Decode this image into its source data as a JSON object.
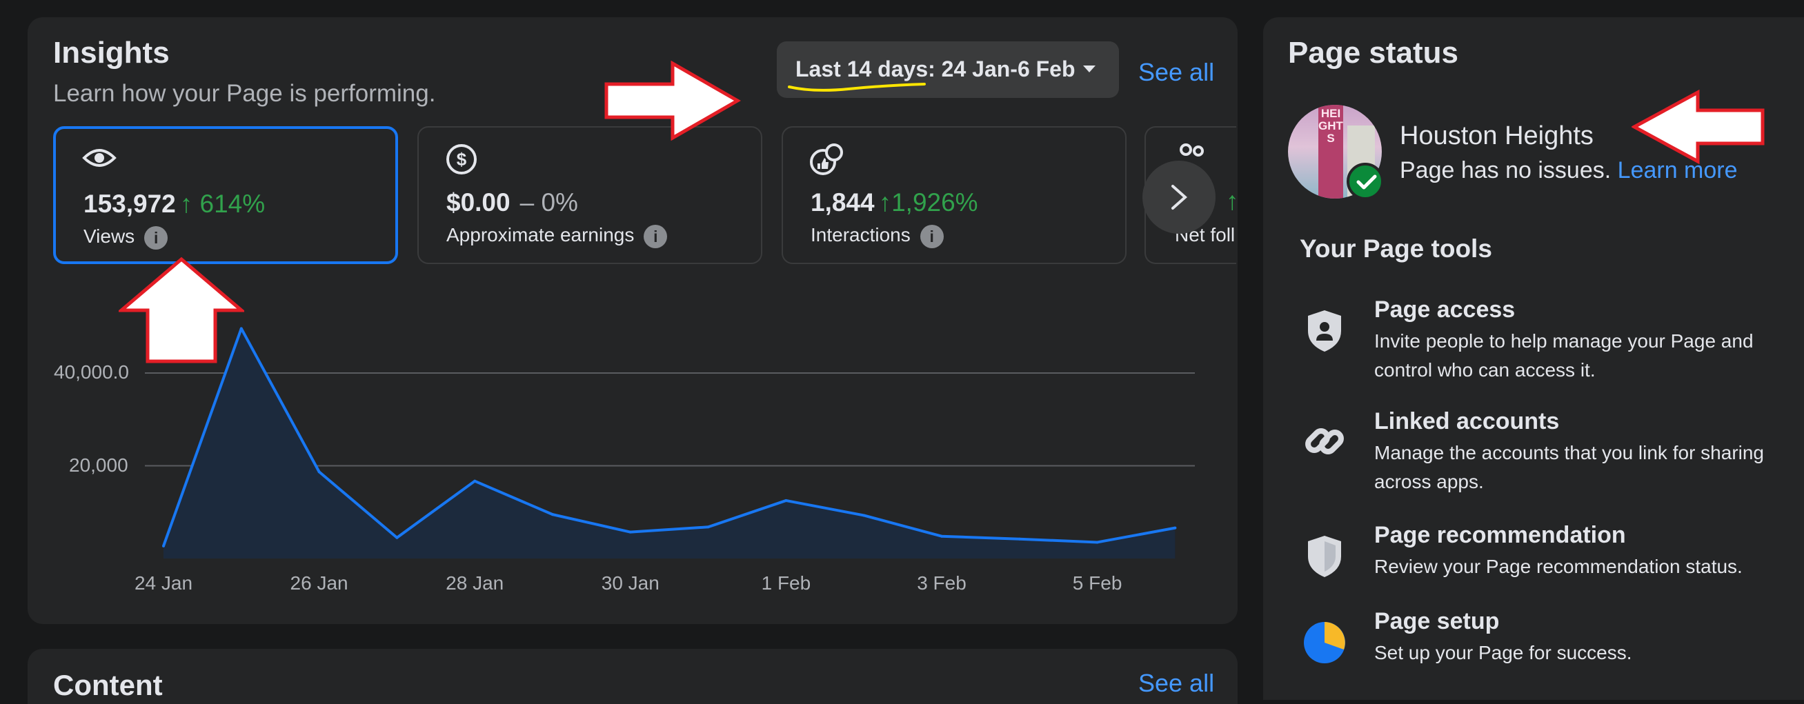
{
  "insights": {
    "title": "Insights",
    "subtitle": "Learn how your Page is performing.",
    "date_range_label": "Last 14 days: 24 Jan-6 Feb",
    "see_all": "See all",
    "metrics": [
      {
        "value": "153,972",
        "change": "614%",
        "change_prefix": "↑",
        "label": "Views",
        "selected": true
      },
      {
        "value": "$0.00",
        "change": "– 0%",
        "change_prefix": "",
        "label": "Approximate earnings",
        "selected": false
      },
      {
        "value": "1,844",
        "change": "1,926%",
        "change_prefix": "↑",
        "label": "Interactions",
        "selected": false
      },
      {
        "value": "",
        "change": "",
        "change_prefix": "↑",
        "label": "Net foll",
        "selected": false
      }
    ],
    "info_glyph": "i"
  },
  "chart_data": {
    "type": "area",
    "x": [
      "24 Jan",
      "25 Jan",
      "26 Jan",
      "27 Jan",
      "28 Jan",
      "29 Jan",
      "30 Jan",
      "31 Jan",
      "1 Feb",
      "2 Feb",
      "3 Feb",
      "4 Feb",
      "5 Feb",
      "6 Feb"
    ],
    "x_tick_labels": [
      "24 Jan",
      "26 Jan",
      "28 Jan",
      "30 Jan",
      "1 Feb",
      "3 Feb",
      "5 Feb"
    ],
    "series": [
      {
        "values": [
          2700,
          49600,
          18700,
          4500,
          16700,
          9500,
          5700,
          6800,
          12500,
          9300,
          4800,
          4200,
          3500,
          6600
        ]
      }
    ],
    "y_tick_labels": [
      "40,000.0",
      "20,000"
    ],
    "y_ticks": [
      40000,
      20000
    ],
    "ylim": [
      0,
      50000
    ],
    "grid": true,
    "line_color": "#1877f2"
  },
  "content_card": {
    "title": "Content",
    "see_all": "See all"
  },
  "page_status": {
    "title": "Page status",
    "page_name": "Houston Heights",
    "status_text": "Page has no issues.",
    "learn_more": "Learn more",
    "avatar_sign_text": "HEIGHTS"
  },
  "tools": {
    "title": "Your Page tools",
    "items": [
      {
        "title": "Page access",
        "desc": "Invite people to help manage your Page and control who can access it.",
        "icon": "shield-person-icon"
      },
      {
        "title": "Linked accounts",
        "desc": "Manage the accounts that you link for sharing across apps.",
        "icon": "link-icon"
      },
      {
        "title": "Page recommendation",
        "desc": "Review your Page recommendation status.",
        "icon": "shield-icon"
      },
      {
        "title": "Page setup",
        "desc": "Set up your Page for success.",
        "icon": "progress-pie-icon"
      }
    ]
  },
  "colors": {
    "background": "#18191a",
    "card": "#242526",
    "accent_blue": "#1877f2",
    "link_blue": "#4599ff",
    "positive_green": "#31a24c",
    "annotation_red": "#e41e26",
    "highlight_yellow": "#ffe600"
  }
}
